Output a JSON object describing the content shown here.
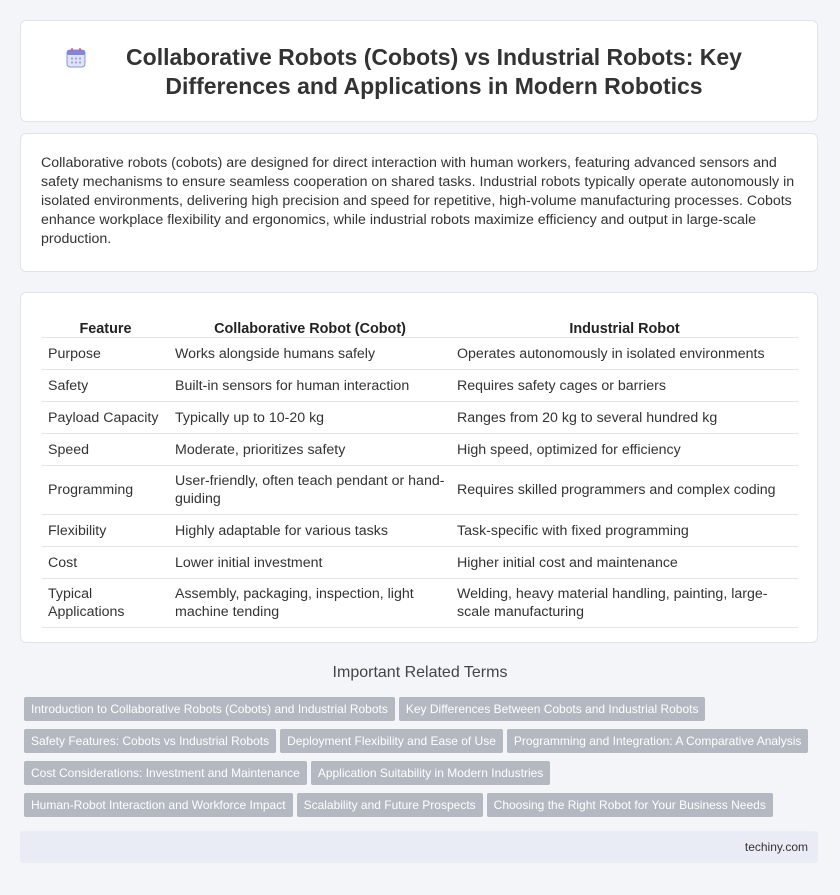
{
  "header": {
    "title": "Collaborative Robots (Cobots) vs Industrial Robots: Key Differences and Applications in Modern Robotics",
    "icon": "calendar-icon"
  },
  "summary": "Collaborative robots (cobots) are designed for direct interaction with human workers, featuring advanced sensors and safety mechanisms to ensure seamless cooperation on shared tasks. Industrial robots typically operate autonomously in isolated environments, delivering high precision and speed for repetitive, high-volume manufacturing processes. Cobots enhance workplace flexibility and ergonomics, while industrial robots maximize efficiency and output in large-scale production.",
  "table": {
    "headers": [
      "Feature",
      "Collaborative Robot (Cobot)",
      "Industrial Robot"
    ],
    "rows": [
      [
        "Purpose",
        "Works alongside humans safely",
        "Operates autonomously in isolated environments"
      ],
      [
        "Safety",
        "Built-in sensors for human interaction",
        "Requires safety cages or barriers"
      ],
      [
        "Payload Capacity",
        "Typically up to 10-20 kg",
        "Ranges from 20 kg to several hundred kg"
      ],
      [
        "Speed",
        "Moderate, prioritizes safety",
        "High speed, optimized for efficiency"
      ],
      [
        "Programming",
        "User-friendly, often teach pendant or hand-guiding",
        "Requires skilled programmers and complex coding"
      ],
      [
        "Flexibility",
        "Highly adaptable for various tasks",
        "Task-specific with fixed programming"
      ],
      [
        "Cost",
        "Lower initial investment",
        "Higher initial cost and maintenance"
      ],
      [
        "Typical Applications",
        "Assembly, packaging, inspection, light machine tending",
        "Welding, heavy material handling, painting, large-scale manufacturing"
      ]
    ]
  },
  "related": {
    "title": "Important Related Terms",
    "tags": [
      "Introduction to Collaborative Robots (Cobots) and Industrial Robots",
      "Key Differences Between Cobots and Industrial Robots",
      "Safety Features: Cobots vs Industrial Robots",
      "Deployment Flexibility and Ease of Use",
      "Programming and Integration: A Comparative Analysis",
      "Cost Considerations: Investment and Maintenance",
      "Application Suitability in Modern Industries",
      "Human-Robot Interaction and Workforce Impact",
      "Scalability and Future Prospects",
      "Choosing the Right Robot for Your Business Needs"
    ]
  },
  "footer": {
    "site": "techiny.com"
  },
  "colors": {
    "tag_bg": "#b3b8c1",
    "footer_bg": "#e9ecf4",
    "page_bg": "#f4f5f8"
  }
}
